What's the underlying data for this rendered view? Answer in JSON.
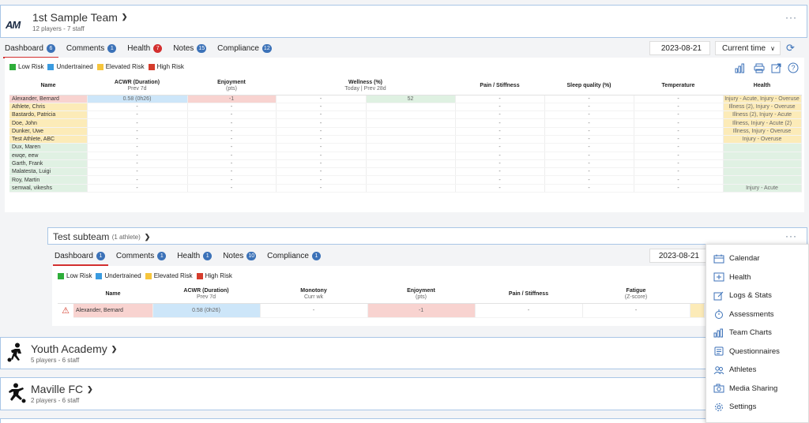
{
  "team1": {
    "name": "1st Sample Team",
    "sub": "12 players - 7 staff",
    "tabs": [
      {
        "label": "Dashboard",
        "count": "6",
        "badge": "blue"
      },
      {
        "label": "Comments",
        "count": "1",
        "badge": "blue"
      },
      {
        "label": "Health",
        "count": "7",
        "badge": "red"
      },
      {
        "label": "Notes",
        "count": "15",
        "badge": "blue"
      },
      {
        "label": "Compliance",
        "count": "12",
        "badge": "blue"
      }
    ],
    "date": "2023-08-21",
    "time_select": "Current time",
    "legend": [
      "Low Risk",
      "Undertrained",
      "Elevated Risk",
      "High Risk"
    ],
    "legend_colors": [
      "#2eae3a",
      "#3a9be0",
      "#f6c53c",
      "#d53c2c"
    ],
    "columns": [
      {
        "label": "Name",
        "sub": ""
      },
      {
        "label": "ACWR (Duration)",
        "sub": "Prev 7d"
      },
      {
        "label": "Enjoyment",
        "sub": "(pts)"
      },
      {
        "label": "Wellness (%)",
        "sub": "Today | Prev 28d"
      },
      {
        "label": "Pain / Stiffness",
        "sub": ""
      },
      {
        "label": "Sleep quality (%)",
        "sub": ""
      },
      {
        "label": "Temperature",
        "sub": ""
      },
      {
        "label": "Health",
        "sub": ""
      }
    ],
    "rows": [
      {
        "name": "Alexander, Bernard",
        "acwr": "0.58 (0h26)",
        "enjoy": "-1",
        "well1": "-",
        "well2": "52",
        "pain": "-",
        "sleep": "-",
        "temp": "-",
        "health": "Injury - Acute, Injury - Overuse",
        "status": "pnk"
      },
      {
        "name": "Athlete, Chris",
        "acwr": "-",
        "enjoy": "-",
        "well1": "-",
        "well2": "",
        "pain": "-",
        "sleep": "-",
        "temp": "-",
        "health": "Illness (2), Injury - Overuse",
        "status": "yel"
      },
      {
        "name": "Bastardo, Patricia",
        "acwr": "-",
        "enjoy": "-",
        "well1": "-",
        "well2": "",
        "pain": "-",
        "sleep": "-",
        "temp": "-",
        "health": "Illness (2), Injury - Acute",
        "status": "yel"
      },
      {
        "name": "Doe, John",
        "acwr": "-",
        "enjoy": "-",
        "well1": "-",
        "well2": "",
        "pain": "-",
        "sleep": "-",
        "temp": "-",
        "health": "Illness, Injury - Acute (2)",
        "status": "yel"
      },
      {
        "name": "Dunker, Uwe",
        "acwr": "-",
        "enjoy": "-",
        "well1": "-",
        "well2": "",
        "pain": "-",
        "sleep": "-",
        "temp": "-",
        "health": "Illness, Injury - Overuse",
        "status": "yel"
      },
      {
        "name": "Test Athlete, ABC",
        "acwr": "-",
        "enjoy": "-",
        "well1": "-",
        "well2": "",
        "pain": "-",
        "sleep": "-",
        "temp": "-",
        "health": "Injury - Overuse",
        "status": "yel"
      },
      {
        "name": "Dux, Maren",
        "acwr": "-",
        "enjoy": "-",
        "well1": "-",
        "well2": "",
        "pain": "-",
        "sleep": "-",
        "temp": "-",
        "health": "",
        "status": "grn"
      },
      {
        "name": "ewqe, eew",
        "acwr": "-",
        "enjoy": "-",
        "well1": "-",
        "well2": "",
        "pain": "-",
        "sleep": "-",
        "temp": "-",
        "health": "",
        "status": "grn"
      },
      {
        "name": "Garth, Frank",
        "acwr": "-",
        "enjoy": "-",
        "well1": "-",
        "well2": "",
        "pain": "-",
        "sleep": "-",
        "temp": "-",
        "health": "",
        "status": "grn"
      },
      {
        "name": "Malatesta, Luigi",
        "acwr": "-",
        "enjoy": "-",
        "well1": "-",
        "well2": "",
        "pain": "-",
        "sleep": "-",
        "temp": "-",
        "health": "",
        "status": "grn"
      },
      {
        "name": "Roy, Martin",
        "acwr": "-",
        "enjoy": "-",
        "well1": "-",
        "well2": "",
        "pain": "-",
        "sleep": "-",
        "temp": "-",
        "health": "",
        "status": "grn"
      },
      {
        "name": "semwal, vikeshs",
        "acwr": "-",
        "enjoy": "-",
        "well1": "-",
        "well2": "",
        "pain": "-",
        "sleep": "-",
        "temp": "-",
        "health": "Injury - Acute",
        "status": "grn"
      }
    ]
  },
  "team2": {
    "name": "Test subteam",
    "count": "(1 athlete)",
    "tabs": [
      {
        "label": "Dashboard",
        "count": "1"
      },
      {
        "label": "Comments",
        "count": "1"
      },
      {
        "label": "Health",
        "count": "1"
      },
      {
        "label": "Notes",
        "count": "10"
      },
      {
        "label": "Compliance",
        "count": "1"
      }
    ],
    "date": "2023-08-21",
    "legend": [
      "Low Risk",
      "Undertrained",
      "Elevated Risk",
      "High Risk"
    ],
    "columns": [
      {
        "label": "Name",
        "sub": ""
      },
      {
        "label": "ACWR (Duration)",
        "sub": "Prev 7d"
      },
      {
        "label": "Monotony",
        "sub": "Curr wk"
      },
      {
        "label": "Enjoyment",
        "sub": "(pts)"
      },
      {
        "label": "Pain / Stiffness",
        "sub": ""
      },
      {
        "label": "Fatigue",
        "sub": "(Z-score)"
      }
    ],
    "row": {
      "name": "Alexander, Bernard",
      "acwr": "0.58 (0h26)",
      "mono": "-",
      "enjoy": "-1",
      "pain": "-",
      "fatigue": "-"
    }
  },
  "team3": {
    "name": "Youth Academy",
    "sub": "5 players - 6 staff"
  },
  "team4": {
    "name": "Maville FC",
    "sub": "2 players - 6 staff"
  },
  "menu": [
    {
      "label": "Calendar",
      "icon": "calendar-icon"
    },
    {
      "label": "Health",
      "icon": "health-plus-icon"
    },
    {
      "label": "Logs & Stats",
      "icon": "logs-edit-icon"
    },
    {
      "label": "Assessments",
      "icon": "stopwatch-icon"
    },
    {
      "label": "Team Charts",
      "icon": "bar-chart-icon"
    },
    {
      "label": "Questionnaires",
      "icon": "questionnaire-icon"
    },
    {
      "label": "Athletes",
      "icon": "athletes-icon"
    },
    {
      "label": "Media Sharing",
      "icon": "camera-icon"
    },
    {
      "label": "Settings",
      "icon": "settings-gear-icon"
    }
  ],
  "logo_text": "AM",
  "more": "···"
}
